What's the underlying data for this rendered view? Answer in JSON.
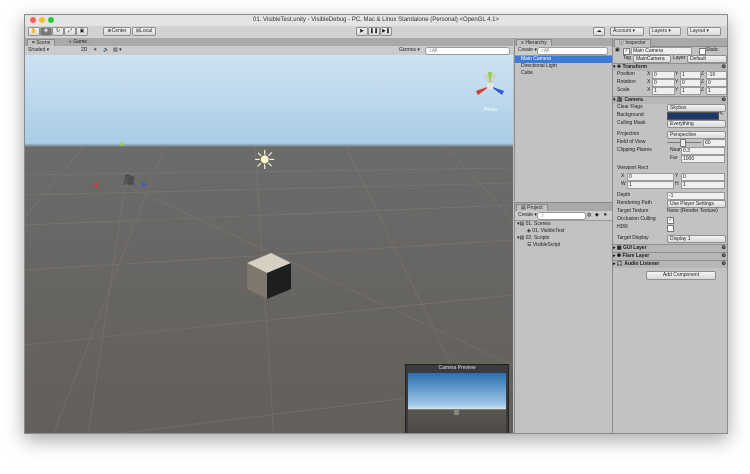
{
  "window": {
    "title": "01. VisibleTest.unity - VisibleDebug - PC, Mac & Linux Standalone (Personal) <OpenGL 4.1>"
  },
  "toolbar": {
    "pivot_label": "Center",
    "space_label": "Local",
    "play_icon": "▶",
    "pause_icon": "❚❚",
    "step_icon": "▶❚",
    "account_label": "Account",
    "layers_label": "Layers",
    "layout_label": "Layout"
  },
  "scene": {
    "tab_scene": "Scene",
    "tab_game": "Game",
    "shading": "Shaded",
    "mode2d": "2D",
    "gizmos": "Gizmos",
    "search_placeholder": "All",
    "persp_label": "Persp",
    "camera_preview_title": "Camera Preview",
    "colors": {
      "sky": "#a9cde6",
      "ground": "#625e59"
    }
  },
  "hierarchy": {
    "tab": "Hierarchy",
    "create": "Create",
    "search_placeholder": "All",
    "items": [
      "Main Camera",
      "Directional Light",
      "Cube"
    ]
  },
  "project": {
    "tab": "Project",
    "create": "Create",
    "tree": [
      {
        "label": "01. Scenes",
        "level": 0
      },
      {
        "label": "01. VisibleTest",
        "level": 1
      },
      {
        "label": "02. Scripts",
        "level": 0
      },
      {
        "label": "VisibleScript",
        "level": 1
      }
    ]
  },
  "inspector": {
    "tab": "Inspector",
    "object_name": "Main Camera",
    "static_label": "Static",
    "tag_label": "Tag",
    "tag_value": "MainCamera",
    "layer_label": "Layer",
    "layer_value": "Default",
    "transform": {
      "title": "Transform",
      "position": {
        "label": "Position",
        "x": "0",
        "y": "1",
        "z": "-10"
      },
      "rotation": {
        "label": "Rotation",
        "x": "0",
        "y": "0",
        "z": "0"
      },
      "scale": {
        "label": "Scale",
        "x": "1",
        "y": "1",
        "z": "1"
      }
    },
    "camera": {
      "title": "Camera",
      "clear_flags_label": "Clear Flags",
      "clear_flags": "Skybox",
      "background_label": "Background",
      "background_color": "#1f3a6a",
      "culling_mask_label": "Culling Mask",
      "culling_mask": "Everything",
      "projection_label": "Projection",
      "projection": "Perspective",
      "fov_label": "Field of View",
      "fov": "60",
      "clipping_label": "Clipping Planes",
      "near_label": "Near",
      "near": "0.3",
      "far_label": "Far",
      "far": "1000",
      "viewport_label": "Viewport Rect",
      "vx": "0",
      "vy": "0",
      "vw": "1",
      "vh": "1",
      "depth_label": "Depth",
      "depth": "-1",
      "rendering_path_label": "Rendering Path",
      "rendering_path": "Use Player Settings",
      "target_texture_label": "Target Texture",
      "target_texture": "None (Render Texture)",
      "occlusion_label": "Occlusion Culling",
      "hdr_label": "HDR",
      "target_display_label": "Target Display",
      "target_display": "Display 1"
    },
    "components": [
      "GUI Layer",
      "Flare Layer",
      "Audio Listener"
    ],
    "add_component": "Add Component"
  }
}
